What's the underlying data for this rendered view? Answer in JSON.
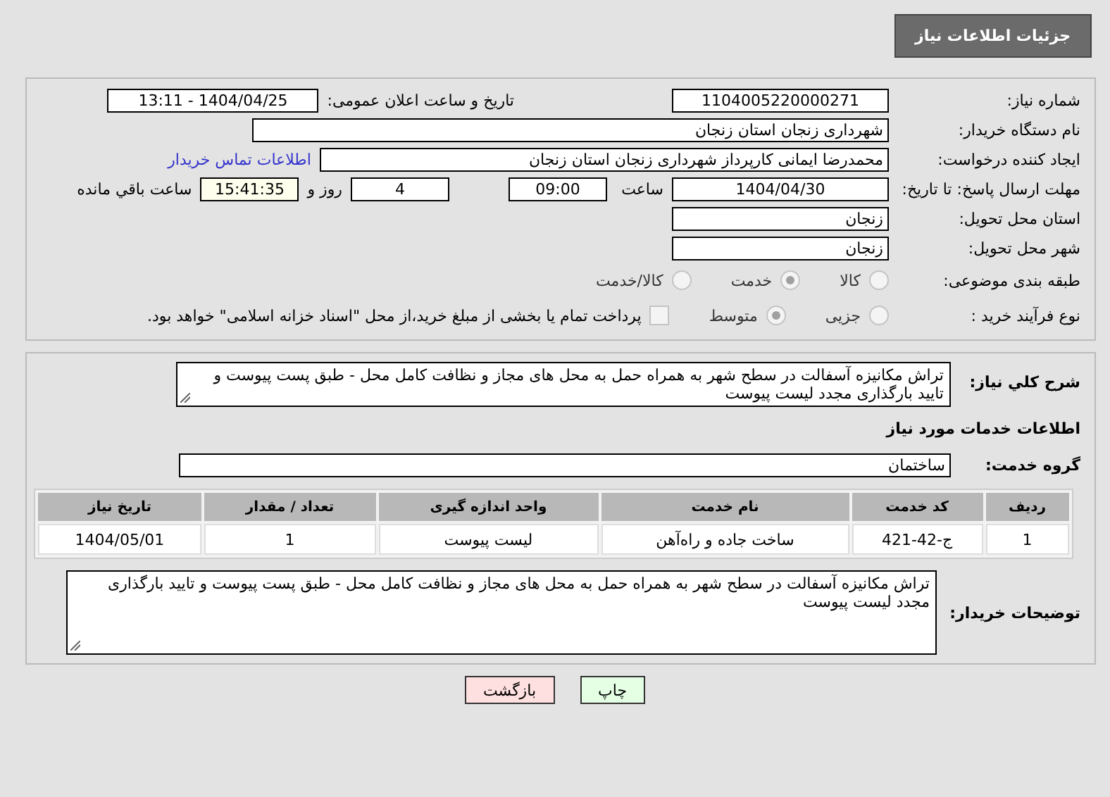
{
  "header": {
    "title": "جزئیات اطلاعات نیاز"
  },
  "details": {
    "need_number": {
      "label": "شماره نیاز:",
      "value": "1104005220000271"
    },
    "announce": {
      "label": "تاریخ و ساعت اعلان عمومی:",
      "value": "1404/04/25 - 13:11"
    },
    "buyer_org": {
      "label": "نام دستگاه خریدار:",
      "value": "شهرداری زنجان استان زنجان"
    },
    "requester": {
      "label": "ایجاد کننده درخواست:",
      "value": "محمدرضا  ایمانی کارپرداز شهرداری زنجان استان زنجان"
    },
    "contact_link": "اطلاعات تماس خریدار",
    "deadline": {
      "label": "مهلت ارسال پاسخ: تا تاریخ:",
      "date": "1404/04/30",
      "time_label": "ساعت",
      "time": "09:00",
      "days": "4",
      "days_label": "روز و",
      "remaining": "15:41:35",
      "remaining_label": "ساعت باقي مانده"
    },
    "province": {
      "label": "استان محل تحویل:",
      "value": "زنجان"
    },
    "city": {
      "label": "شهر محل تحویل:",
      "value": "زنجان"
    },
    "category": {
      "label": "طبقه بندی موضوعی:",
      "options": [
        {
          "label": "کالا",
          "selected": false
        },
        {
          "label": "خدمت",
          "selected": true
        },
        {
          "label": "کالا/خدمت",
          "selected": false
        }
      ]
    },
    "process": {
      "label": "نوع فرآیند خرید :",
      "options": [
        {
          "label": "جزیی",
          "selected": false
        },
        {
          "label": "متوسط",
          "selected": true
        }
      ],
      "payment": {
        "checked": false,
        "label": "پرداخت تمام یا بخشی از مبلغ خرید،از محل \"اسناد خزانه اسلامی\" خواهد بود."
      }
    }
  },
  "description": {
    "label": "شرح کلي نیاز:",
    "value": "تراش مکانیزه آسفالت در سطح شهر به همراه حمل به محل های مجاز و نظافت کامل محل - طبق پست پیوست و تایید بارگذاری مجدد لیست پیوست"
  },
  "services": {
    "title": "اطلاعات خدمات مورد نیاز",
    "group": {
      "label": "گروه خدمت:",
      "value": "ساختمان"
    },
    "table": {
      "columns": [
        "ردیف",
        "کد خدمت",
        "نام خدمت",
        "واحد اندازه گیری",
        "تعداد / مقدار",
        "تاریخ نیاز"
      ],
      "rows": [
        [
          "1",
          "ج-42-421",
          "ساخت جاده و راه‌آهن",
          "لیست پیوست",
          "1",
          "1404/05/01"
        ]
      ]
    }
  },
  "buyer_notes": {
    "label": "توضیحات خریدار:",
    "value": "تراش مکانیزه آسفالت در سطح شهر به همراه حمل به محل های مجاز و نظافت کامل محل - طبق پست پیوست و تایید بارگذاری مجدد لیست پیوست"
  },
  "buttons": [
    {
      "label": "چاپ",
      "kind": "print"
    },
    {
      "label": "بازگشت",
      "kind": "back"
    }
  ]
}
